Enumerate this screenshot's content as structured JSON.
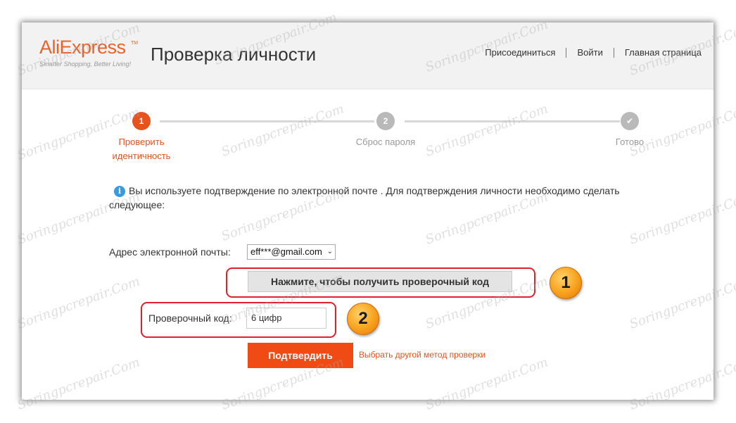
{
  "header": {
    "logo_text": "AliExpress",
    "logo_tm": "TM",
    "logo_tagline": "Smarter Shopping, Better Living!",
    "title": "Проверка личности",
    "nav": [
      "Присоединиться",
      "Войти",
      "Главная страница"
    ]
  },
  "steps": [
    {
      "number": "1",
      "label_line1": "Проверить",
      "label_line2": "идентичность",
      "state": "active"
    },
    {
      "number": "2",
      "label_line1": "Сброс пароля",
      "label_line2": "",
      "state": "inactive"
    },
    {
      "number": "✔",
      "label_line1": "Готово",
      "label_line2": "",
      "state": "inactive"
    }
  ],
  "info": {
    "text": "Вы используете подтверждение по электронной почте . Для подтверждения личности необходимо сделать следующее:"
  },
  "form": {
    "email_label": "Адрес электронной почты:",
    "email_value": "eff***@gmail.com",
    "get_code_button": "Нажмите, чтобы получить проверочный код",
    "code_label": "Проверочный код:",
    "code_placeholder": "6 цифр",
    "confirm_button": "Подтвердить",
    "other_method_link": "Выбрать другой метод проверки"
  },
  "annotations": [
    "1",
    "2"
  ],
  "watermark": "Soringpcrepair.Com",
  "colors": {
    "accent": "#e8521c",
    "callout": "#e0202a",
    "info": "#3a9ae0"
  }
}
